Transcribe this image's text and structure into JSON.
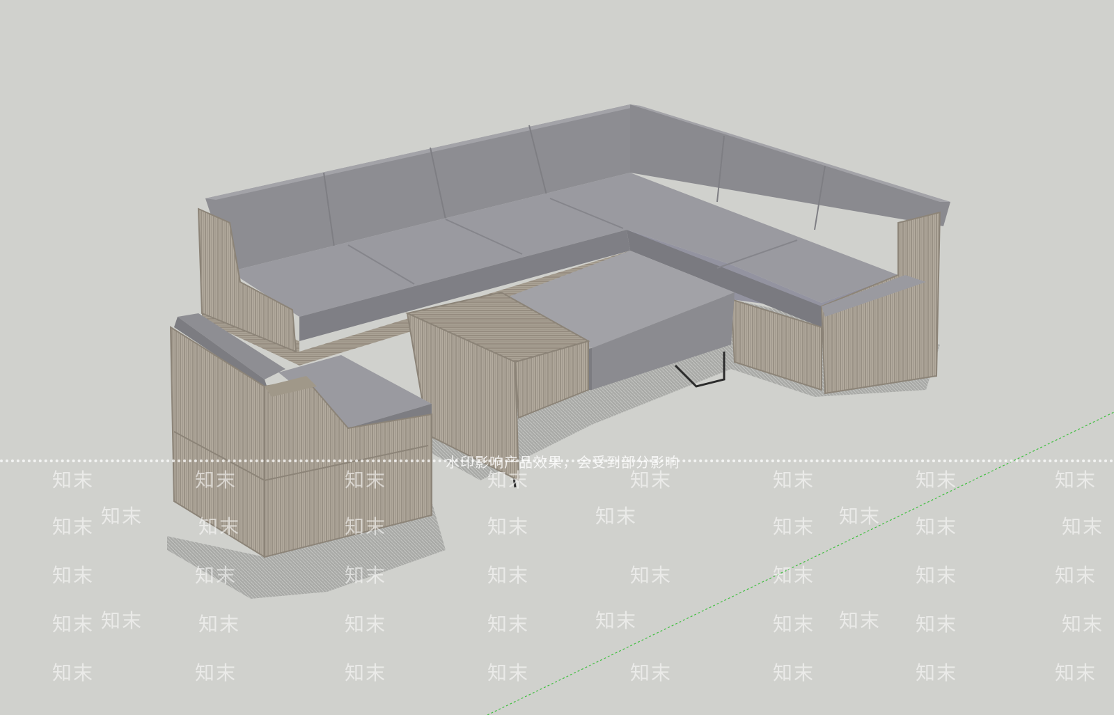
{
  "scene": {
    "background_color": "#d0d1cd",
    "ground_color": "#c9cac6",
    "cushion_color": "#8f8f94",
    "cushion_top_color": "#9a9aa0",
    "rope_color": "#a39a8c",
    "frame_color": "#8c8478",
    "shadow_color": "#a6a7a4",
    "axis_color": "#3fbf3f"
  },
  "objects": [
    {
      "name": "sectional-sofa",
      "icon": "sofa-icon"
    },
    {
      "name": "lounge-armchair",
      "icon": "armchair-icon"
    },
    {
      "name": "coffee-table",
      "icon": "table-icon"
    },
    {
      "name": "rope-side-table",
      "icon": "side-table-icon"
    },
    {
      "name": "green-axis-line",
      "icon": "axis-icon"
    }
  ],
  "watermark": {
    "brand": "知末",
    "notice": "水印影响产品效果，会受到部分影响"
  }
}
